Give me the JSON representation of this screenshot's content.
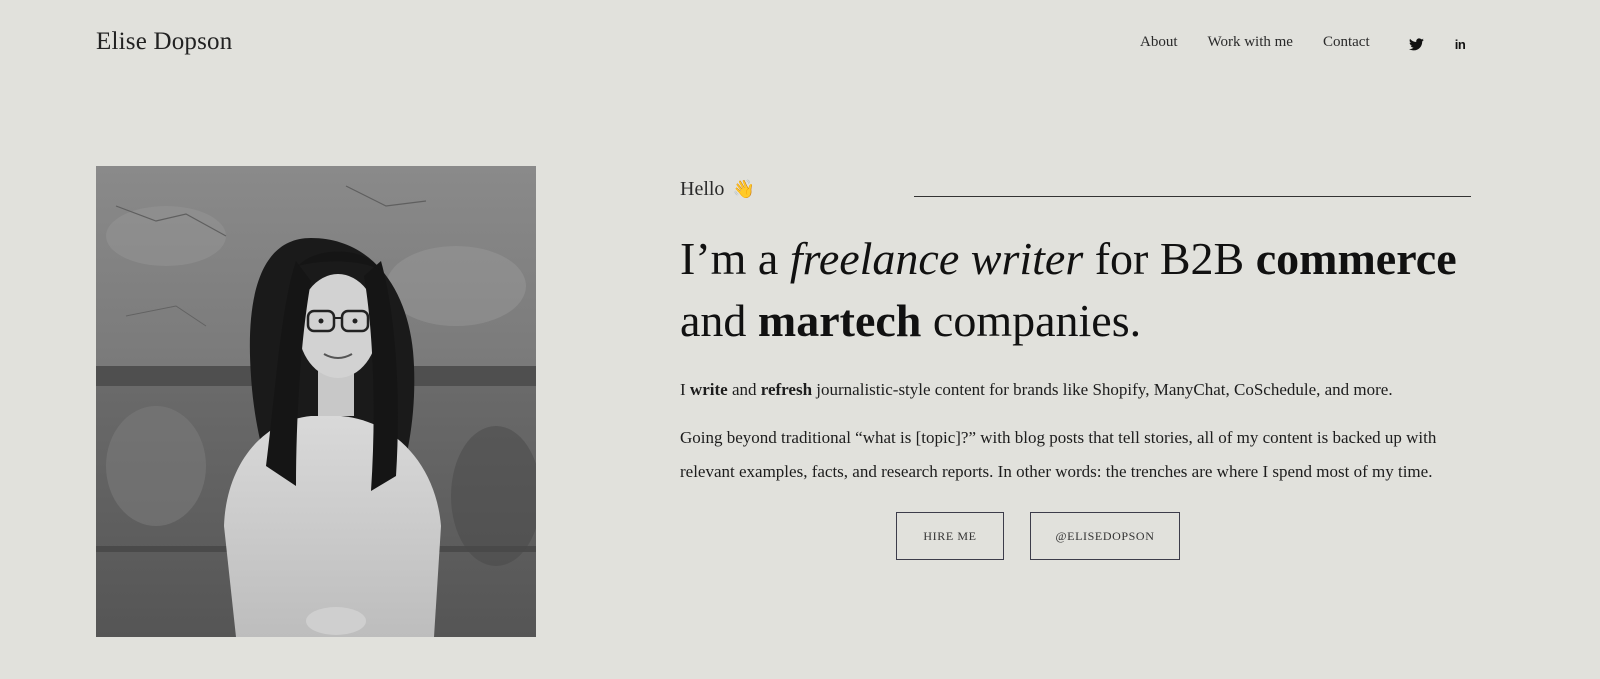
{
  "header": {
    "brand": "Elise Dopson",
    "nav": [
      {
        "label": "About"
      },
      {
        "label": "Work with me"
      },
      {
        "label": "Contact"
      }
    ],
    "social": [
      {
        "icon": "twitter-icon"
      },
      {
        "icon": "linkedin-icon",
        "glyph": "in"
      }
    ]
  },
  "hero": {
    "hello": "Hello",
    "wave": "👋",
    "headline": {
      "p1": "I’m a ",
      "p2": "freelance writer",
      "p3": " for B2B ",
      "p4": "commerce",
      "p5": " and ",
      "p6": "martech",
      "p7": " companies."
    },
    "para1": {
      "p1": "I ",
      "p2": "write",
      "p3": " and ",
      "p4": "refresh",
      "p5": " journalistic-style content for brands like Shopify, ManyChat, CoSchedule, and more."
    },
    "para2": "Going beyond traditional “what is [topic]?” with blog posts that tell stories, all of my content is backed up with relevant examples, facts, and research reports. In other words: the trenches are where I spend most of my time.",
    "buttons": {
      "hire": "HIRE ME",
      "handle": "@ELISEDOPSON"
    }
  },
  "colors": {
    "background": "#e1e1dc",
    "text": "#1b1b1b",
    "rule": "#333333"
  }
}
